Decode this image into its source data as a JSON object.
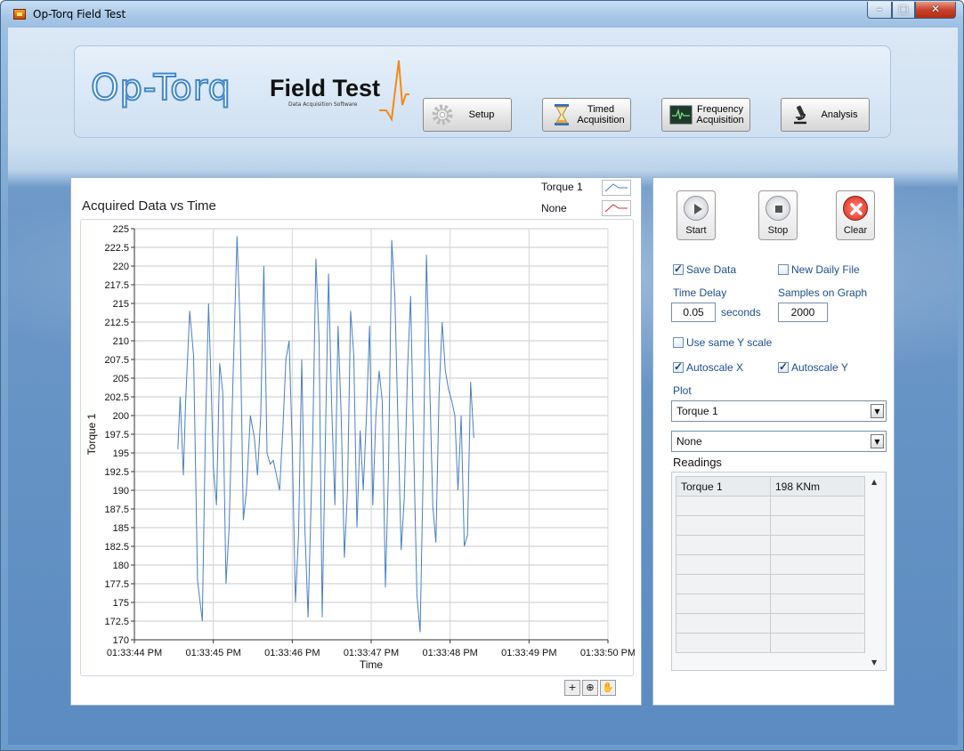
{
  "window": {
    "title": "Op-Torq Field Test"
  },
  "brand": {
    "logo_main": "Op-Torq",
    "logo_product": "Field Test",
    "logo_subtitle": "Data Acquisition Software",
    "accent": "#3f86c8"
  },
  "nav": {
    "setup": "Setup",
    "timed_line1": "Timed",
    "timed_line2": "Acquisition",
    "freq_line1": "Frequency",
    "freq_line2": "Acquisition",
    "analysis": "Analysis"
  },
  "graph": {
    "title": "Acquired Data vs Time",
    "legend": [
      {
        "label": "Torque 1",
        "color": "#4a7fc1"
      },
      {
        "label": "None",
        "color": "#d62c2c"
      }
    ],
    "tools": [
      "cursor-icon",
      "zoom-icon",
      "pan-hand-icon"
    ]
  },
  "chart_data": {
    "type": "line",
    "title": "Acquired Data vs Time",
    "xlabel": "Time",
    "ylabel": "Torque 1",
    "ylim": [
      170,
      225
    ],
    "y_ticks": [
      225,
      222.5,
      220,
      217.5,
      215,
      212.5,
      210,
      207.5,
      205,
      202.5,
      200,
      197.5,
      195,
      192.5,
      190,
      187.5,
      185,
      182.5,
      180,
      177.5,
      175,
      172.5,
      170
    ],
    "x_ticks": [
      "01:33:44 PM",
      "01:33:45 PM",
      "01:33:46 PM",
      "01:33:47 PM",
      "01:33:48 PM",
      "01:33:49 PM",
      "01:33:50 PM"
    ],
    "xlim": [
      "01:33:44 PM",
      "01:33:50 PM"
    ],
    "grid": true,
    "series": [
      {
        "name": "Torque 1",
        "color": "#4a7fc1",
        "x_seconds_after_013344": [
          0.55,
          0.58,
          0.62,
          0.65,
          0.7,
          0.75,
          0.8,
          0.86,
          0.9,
          0.94,
          0.97,
          1.0,
          1.04,
          1.08,
          1.12,
          1.16,
          1.2,
          1.25,
          1.3,
          1.34,
          1.38,
          1.42,
          1.47,
          1.52,
          1.56,
          1.6,
          1.64,
          1.68,
          1.72,
          1.76,
          1.8,
          1.84,
          1.88,
          1.92,
          1.96,
          2.0,
          2.04,
          2.08,
          2.12,
          2.16,
          2.2,
          2.26,
          2.3,
          2.34,
          2.38,
          2.42,
          2.46,
          2.5,
          2.54,
          2.58,
          2.62,
          2.66,
          2.7,
          2.74,
          2.78,
          2.82,
          2.86,
          2.9,
          2.94,
          2.98,
          3.02,
          3.06,
          3.1,
          3.14,
          3.18,
          3.22,
          3.26,
          3.3,
          3.34,
          3.38,
          3.42,
          3.46,
          3.5,
          3.54,
          3.58,
          3.62,
          3.66,
          3.7,
          3.74,
          3.78,
          3.82,
          3.86,
          3.9,
          3.94,
          3.98,
          4.02,
          4.06,
          4.1,
          4.14,
          4.18,
          4.22,
          4.26,
          4.3,
          4.34,
          4.38,
          4.42,
          4.46,
          4.5,
          4.54,
          4.58,
          4.62,
          4.66,
          4.7,
          4.74,
          4.78,
          4.82,
          4.86,
          4.9,
          4.94,
          4.98,
          5.02,
          5.06,
          5.1,
          5.14,
          5.18,
          5.22,
          5.26
        ],
        "y": [
          195.5,
          202.5,
          192,
          202,
          214,
          208,
          178,
          172.5,
          198,
          215,
          205,
          193,
          188,
          207,
          203,
          177.5,
          185,
          205,
          224,
          212,
          186,
          190,
          200,
          197,
          192,
          200,
          220,
          195,
          193.5,
          194,
          192,
          190,
          198,
          207.5,
          210,
          196,
          175,
          184,
          207.5,
          185,
          173,
          197,
          221,
          210,
          173,
          197,
          219,
          201,
          188,
          212,
          200,
          181,
          190,
          214,
          208,
          185,
          198,
          190,
          200,
          212,
          188,
          200,
          206,
          202,
          177,
          193,
          223.5,
          216,
          199,
          182,
          189,
          206,
          216,
          195,
          176,
          171,
          193,
          221.5,
          205,
          188,
          183,
          203,
          212.5,
          206,
          203.5,
          202,
          200,
          190,
          200,
          182.5,
          184,
          204.5,
          197
        ]
      }
    ]
  },
  "controls": {
    "start": "Start",
    "stop": "Stop",
    "clear": "Clear",
    "save_data": {
      "label": "Save Data",
      "checked": true
    },
    "new_daily_file": {
      "label": "New Daily File",
      "checked": false
    },
    "time_delay_label": "Time Delay",
    "time_delay_value": "0.05",
    "time_delay_unit": "seconds",
    "samples_label": "Samples on Graph",
    "samples_value": "2000",
    "same_y": {
      "label": "Use same Y scale",
      "checked": false
    },
    "autoscale_x": {
      "label": "Autoscale X",
      "checked": true
    },
    "autoscale_y": {
      "label": "Autoscale Y",
      "checked": true
    },
    "plot_label": "Plot",
    "plot_select_1": "Torque 1",
    "plot_select_2": "None",
    "readings_label": "Readings",
    "readings": [
      [
        "Torque 1",
        "198 KNm"
      ],
      [
        "",
        ""
      ],
      [
        "",
        ""
      ],
      [
        "",
        ""
      ],
      [
        "",
        ""
      ],
      [
        "",
        ""
      ],
      [
        "",
        ""
      ],
      [
        "",
        ""
      ],
      [
        "",
        ""
      ]
    ]
  }
}
